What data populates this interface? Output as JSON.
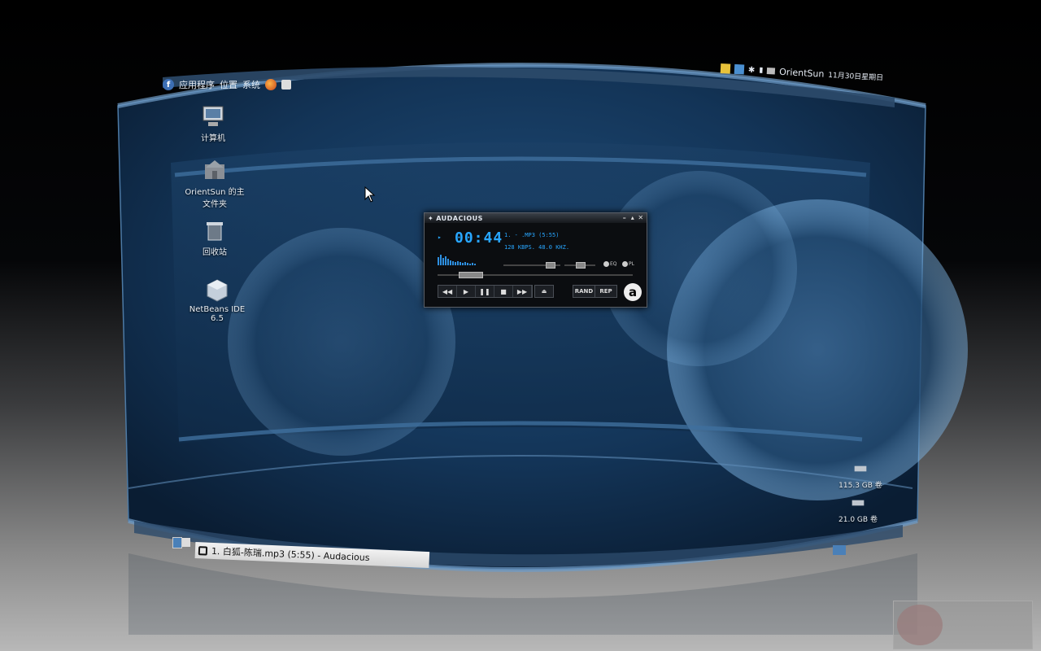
{
  "top_panel": {
    "applications": "应用程序",
    "places": "位置",
    "system": "系统",
    "user": "OrientSun",
    "datetime": "11月30日星期日"
  },
  "desktop_icons": [
    {
      "label": "计算机",
      "icon": "computer-icon"
    },
    {
      "label": "OrientSun 的主文件夹",
      "icon": "home-folder-icon"
    },
    {
      "label": "回收站",
      "icon": "trash-icon"
    },
    {
      "label": "NetBeans IDE 6.5",
      "icon": "netbeans-icon"
    }
  ],
  "drive_labels": [
    {
      "label": "115.3 GB 卷"
    },
    {
      "label": "21.0 GB 卷"
    }
  ],
  "audacious": {
    "title": "AUDACIOUS",
    "time": "00:44",
    "track": "1.   -   .MP3 (5:55)",
    "info": "128 KBPS. 48.0 KHZ.",
    "eq_label": "EQ",
    "pl_label": "PL",
    "rand_label": "RAND",
    "rep_label": "REP",
    "logo": "a"
  },
  "taskbar": {
    "window_title": "1. 白狐-陈瑞.mp3 (5:55) - Audacious"
  },
  "colors": {
    "lcd": "#28a6ff",
    "panel": "#2c4a6a"
  }
}
